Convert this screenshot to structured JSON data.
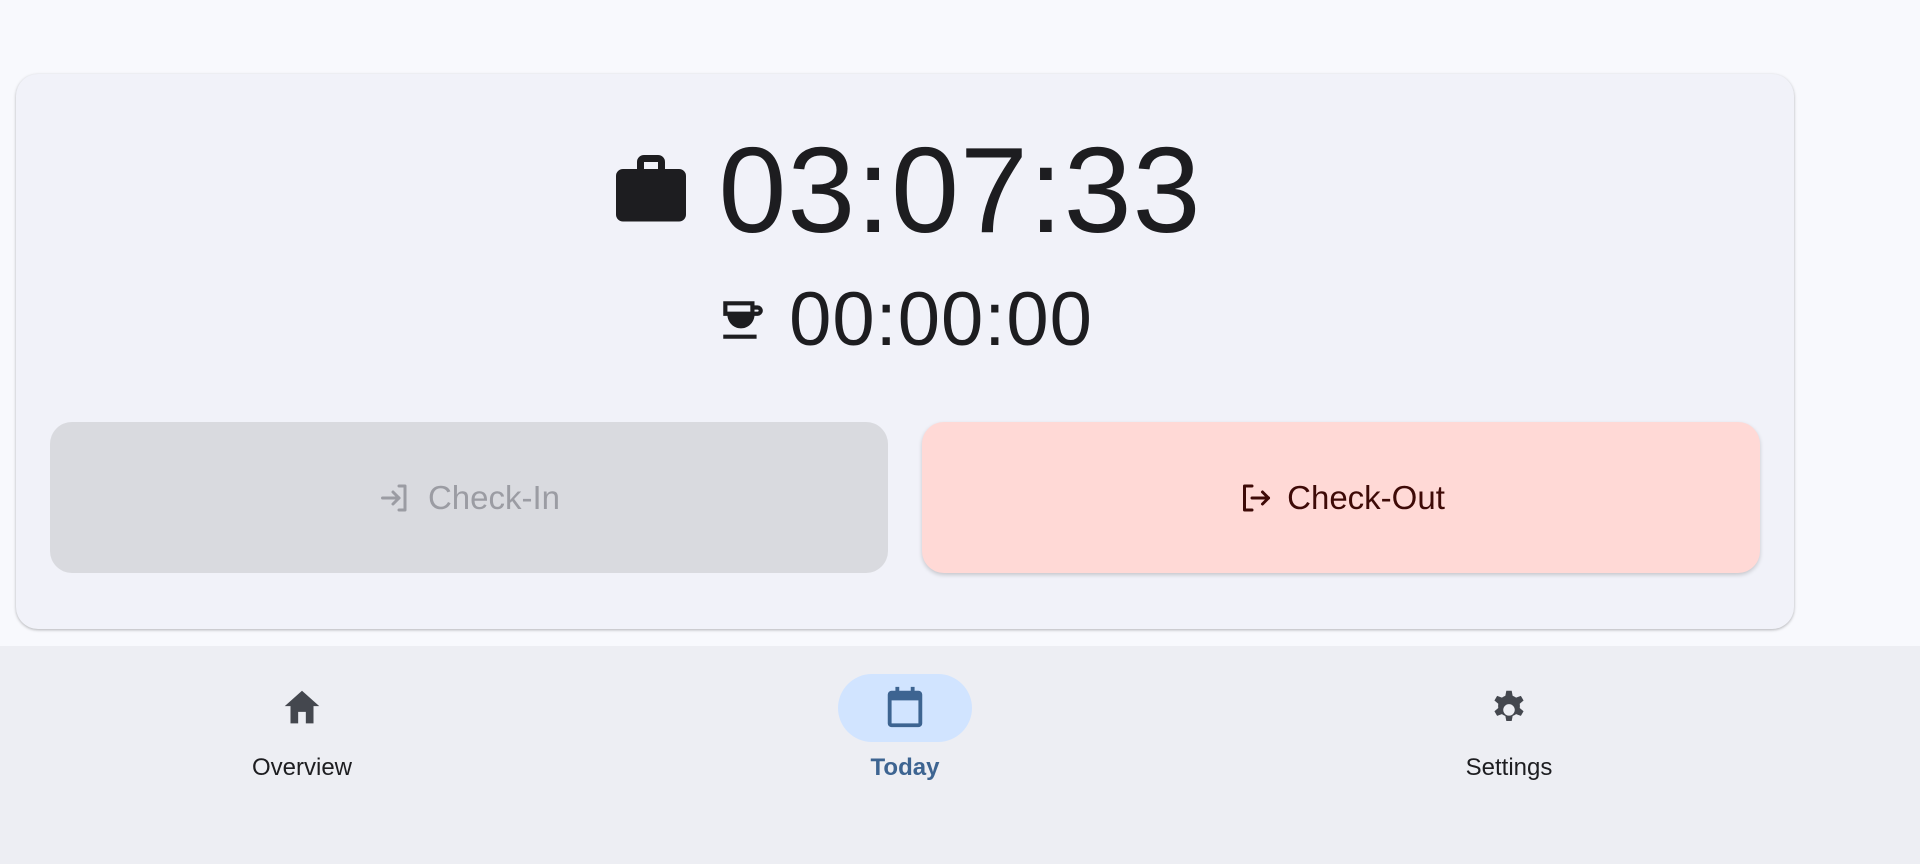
{
  "timer": {
    "work_icon": "briefcase-icon",
    "work_time": "03:07:33",
    "break_icon": "coffee-cup-icon",
    "break_time": "00:00:00"
  },
  "actions": {
    "checkin": {
      "label": "Check-In",
      "icon": "login-icon",
      "enabled": false
    },
    "checkout": {
      "label": "Check-Out",
      "icon": "logout-icon",
      "enabled": true
    }
  },
  "nav": {
    "items": [
      {
        "label": "Overview",
        "icon": "home-icon",
        "active": false
      },
      {
        "label": "Today",
        "icon": "calendar-icon",
        "active": true
      },
      {
        "label": "Settings",
        "icon": "gear-icon",
        "active": false
      }
    ]
  },
  "colors": {
    "card_background": "#f1f2f9",
    "checkin_disabled": "#d9dadf",
    "checkout_background": "#ffd9d6",
    "checkout_text": "#3e0a07",
    "nav_active_indicator": "#d1e4ff",
    "nav_active_text": "#3d6491"
  }
}
